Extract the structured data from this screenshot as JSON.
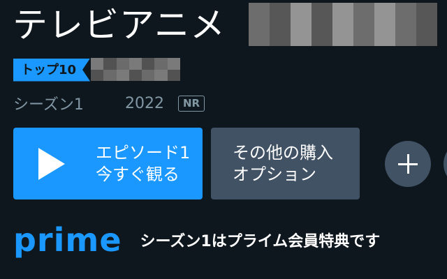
{
  "title": {
    "text": "テレビアニメ",
    "redacted_subtitle": "pixelated title text"
  },
  "badges": {
    "top10": "トップ10",
    "redacted_rank": "pixelated ranking text"
  },
  "meta": {
    "season": "シーズン1",
    "year": "2022",
    "rating": "NR"
  },
  "buttons": {
    "play_line1": "エピソード1",
    "play_line2": "今すぐ観る",
    "buy_line1": "その他の購入",
    "buy_line2": "オプション",
    "add_icon": "plus-icon",
    "play_icon": "play-icon"
  },
  "prime": {
    "logo": "prime",
    "benefit_text": "シーズン1はプライム会員特典です"
  },
  "colors": {
    "background": "#0f171e",
    "accent": "#1a98ff",
    "secondary_button": "#425265",
    "muted_text": "#8197a4"
  }
}
